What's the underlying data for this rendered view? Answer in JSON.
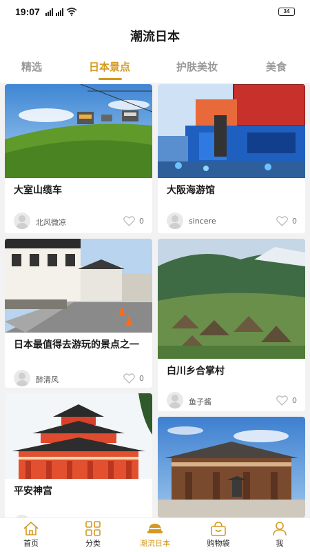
{
  "status": {
    "time": "19:07",
    "battery": "34"
  },
  "header": {
    "title": "潮流日本"
  },
  "tabs": [
    {
      "label": "精选",
      "active": false
    },
    {
      "label": "日本景点",
      "active": true
    },
    {
      "label": "护肤美妆",
      "active": false
    },
    {
      "label": "美食",
      "active": false
    }
  ],
  "cards": [
    {
      "title": "大室山缆车",
      "author": "北风微凉",
      "likes": "0",
      "image": "mountain-cable-car-photo"
    },
    {
      "title": "大阪海游馆",
      "author": "sincere",
      "likes": "0",
      "image": "aquarium-building-photo"
    },
    {
      "title": "日本最值得去游玩的景点之一",
      "author": "醉清风",
      "likes": "0",
      "image": "street-scene-photo"
    },
    {
      "title": "白川乡合掌村",
      "author": "鱼子酱",
      "likes": "0",
      "image": "shirakawa-village-photo"
    },
    {
      "title": "平安神宫",
      "author": "",
      "likes": "",
      "image": "heian-shrine-photo"
    },
    {
      "title": "",
      "author": "",
      "likes": "",
      "image": "temple-hall-photo"
    }
  ],
  "bottom_nav": [
    {
      "label": "首页",
      "icon": "home-icon",
      "active": false
    },
    {
      "label": "分类",
      "icon": "grid-icon",
      "active": false
    },
    {
      "label": "潮流日本",
      "icon": "hat-icon",
      "active": true
    },
    {
      "label": "购物袋",
      "icon": "shopping-bag-icon",
      "active": false
    },
    {
      "label": "我",
      "icon": "user-icon",
      "active": false
    }
  ],
  "colors": {
    "accent": "#d49a1f",
    "background": "#f2f2f2"
  }
}
